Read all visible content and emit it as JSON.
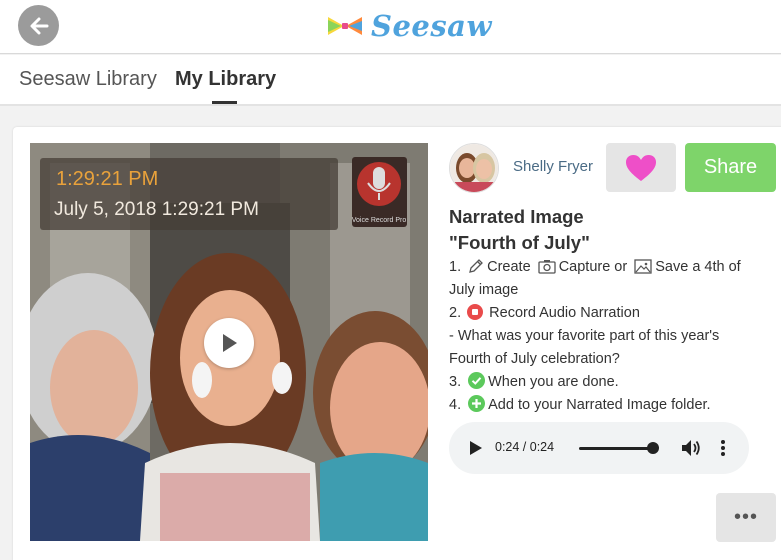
{
  "header": {
    "logo_text": "Seesaw",
    "logo_color": "#4fa3dd"
  },
  "tabs": [
    {
      "label": "Seesaw Library",
      "active": false
    },
    {
      "label": "My Library",
      "active": true
    }
  ],
  "post": {
    "photo": {
      "timestamp_time": "1:29:21 PM",
      "timestamp_date": "July 5, 2018 1:29:21 PM",
      "app_badge": "Voice Record Pro"
    },
    "author": "Shelly Fryer",
    "share_label": "Share",
    "title_line1": "Narrated Image",
    "title_line2": "\"Fourth of July\"",
    "instructions": {
      "s1_num": "1.",
      "s1_create": "Create",
      "s1_capture": "Capture or",
      "s1_save": "Save a 4th of",
      "s1_cont": "July image",
      "s2_num": "2.",
      "s2_text": "Record Audio Narration",
      "q_line1": "- What was your favorite part of this year's",
      "q_line2": "Fourth of July celebration?",
      "s3_num": "3.",
      "s3_text": "When you are done.",
      "s4_num": "4.",
      "s4_text": "Add to your Narrated Image folder."
    },
    "audio": {
      "time": "0:24 / 0:24",
      "progress": 1.0
    },
    "more_label": "•••"
  },
  "colors": {
    "share_green": "#7ed46a",
    "heart_pink": "#ee4fc8",
    "record_red": "#e94b4b",
    "check_green": "#5cc95c",
    "author_blue": "#4a6b85"
  }
}
